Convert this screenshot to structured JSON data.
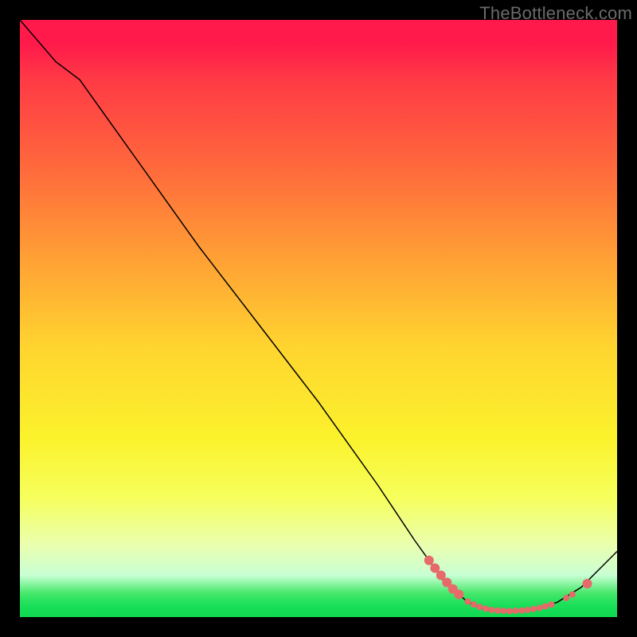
{
  "watermark": "TheBottleneck.com",
  "chart_data": {
    "type": "line",
    "title": "",
    "xlabel": "",
    "ylabel": "",
    "xlim": [
      0,
      100
    ],
    "ylim": [
      0,
      100
    ],
    "curve": [
      {
        "x": 0,
        "y": 100
      },
      {
        "x": 6,
        "y": 93
      },
      {
        "x": 10,
        "y": 90
      },
      {
        "x": 20,
        "y": 76
      },
      {
        "x": 30,
        "y": 62
      },
      {
        "x": 40,
        "y": 49
      },
      {
        "x": 50,
        "y": 36
      },
      {
        "x": 60,
        "y": 22
      },
      {
        "x": 66,
        "y": 13
      },
      {
        "x": 71,
        "y": 6
      },
      {
        "x": 75,
        "y": 2.5
      },
      {
        "x": 78,
        "y": 1.2
      },
      {
        "x": 82,
        "y": 1.0
      },
      {
        "x": 86,
        "y": 1.2
      },
      {
        "x": 90,
        "y": 2.5
      },
      {
        "x": 94,
        "y": 5
      },
      {
        "x": 100,
        "y": 11
      }
    ],
    "markers": [
      {
        "x": 68.5,
        "y": 9.5,
        "size": "lg"
      },
      {
        "x": 69.5,
        "y": 8.2,
        "size": "lg"
      },
      {
        "x": 70.5,
        "y": 7.0,
        "size": "lg"
      },
      {
        "x": 71.5,
        "y": 5.8,
        "size": "lg"
      },
      {
        "x": 72.5,
        "y": 4.7,
        "size": "lg"
      },
      {
        "x": 73.5,
        "y": 3.8,
        "size": "lg"
      },
      {
        "x": 75.0,
        "y": 2.6,
        "size": "sm"
      },
      {
        "x": 76.0,
        "y": 2.1,
        "size": "sm"
      },
      {
        "x": 77.0,
        "y": 1.7,
        "size": "sm"
      },
      {
        "x": 78.0,
        "y": 1.4,
        "size": "sm"
      },
      {
        "x": 79.0,
        "y": 1.2,
        "size": "sm"
      },
      {
        "x": 80.0,
        "y": 1.1,
        "size": "sm"
      },
      {
        "x": 81.0,
        "y": 1.05,
        "size": "sm"
      },
      {
        "x": 82.0,
        "y": 1.0,
        "size": "sm"
      },
      {
        "x": 83.0,
        "y": 1.05,
        "size": "sm"
      },
      {
        "x": 84.0,
        "y": 1.1,
        "size": "sm"
      },
      {
        "x": 85.0,
        "y": 1.2,
        "size": "sm"
      },
      {
        "x": 86.0,
        "y": 1.35,
        "size": "sm"
      },
      {
        "x": 87.0,
        "y": 1.55,
        "size": "sm"
      },
      {
        "x": 88.0,
        "y": 1.8,
        "size": "sm"
      },
      {
        "x": 89.0,
        "y": 2.1,
        "size": "sm"
      },
      {
        "x": 91.5,
        "y": 3.2,
        "size": "sm"
      },
      {
        "x": 92.5,
        "y": 3.8,
        "size": "sm"
      },
      {
        "x": 95.0,
        "y": 5.6,
        "size": "lg"
      }
    ]
  }
}
